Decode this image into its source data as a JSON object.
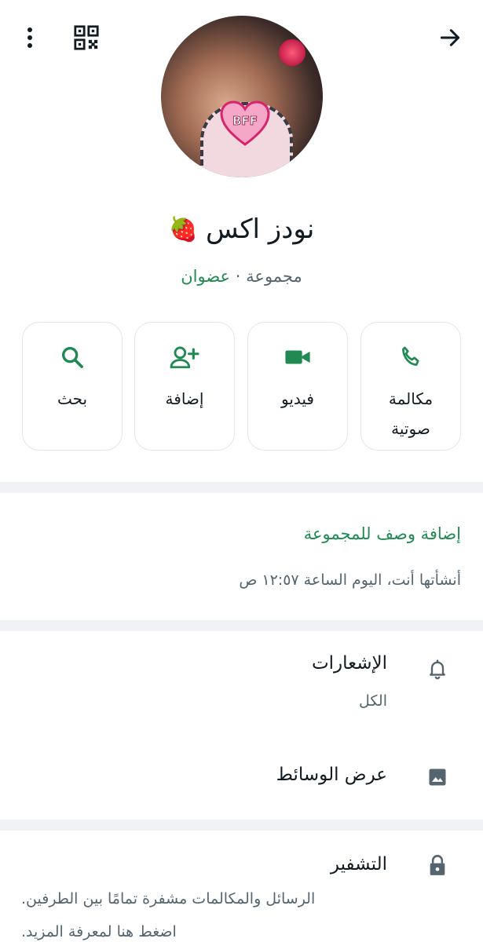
{
  "header": {
    "back_icon": "arrow-right-icon",
    "qr_icon": "qr-code-icon",
    "more_icon": "more-vertical-icon"
  },
  "group": {
    "name": "نودز اكس",
    "emoji": "🍓",
    "type_label": "مجموعة",
    "separator": "·",
    "members_label": "عضوان",
    "avatar_badge": "BFF"
  },
  "actions": [
    {
      "label": "مكالمة صوتية",
      "icon": "phone-icon"
    },
    {
      "label": "فيديو",
      "icon": "video-icon"
    },
    {
      "label": "إضافة",
      "icon": "add-person-icon"
    },
    {
      "label": "بحث",
      "icon": "search-icon"
    }
  ],
  "description": {
    "add_link": "إضافة وصف للمجموعة",
    "created_text": "أنشأتها أنت، اليوم الساعة ١٢:٥٧ ص"
  },
  "settings": {
    "notifications": {
      "title": "الإشعارات",
      "subtitle": "الكل",
      "icon": "bell-icon"
    },
    "media": {
      "title": "عرض الوسائط",
      "icon": "image-icon"
    },
    "encryption": {
      "title": "التشفير",
      "line1": "الرسائل والمكالمات مشفرة تمامًا بين الطرفين.",
      "line2": "اضغط هنا لمعرفة المزيد.",
      "icon": "lock-icon"
    }
  },
  "colors": {
    "accent": "#1f8b52",
    "text": "#111b21",
    "muted": "#54656f",
    "divider": "#f0f2f5"
  }
}
